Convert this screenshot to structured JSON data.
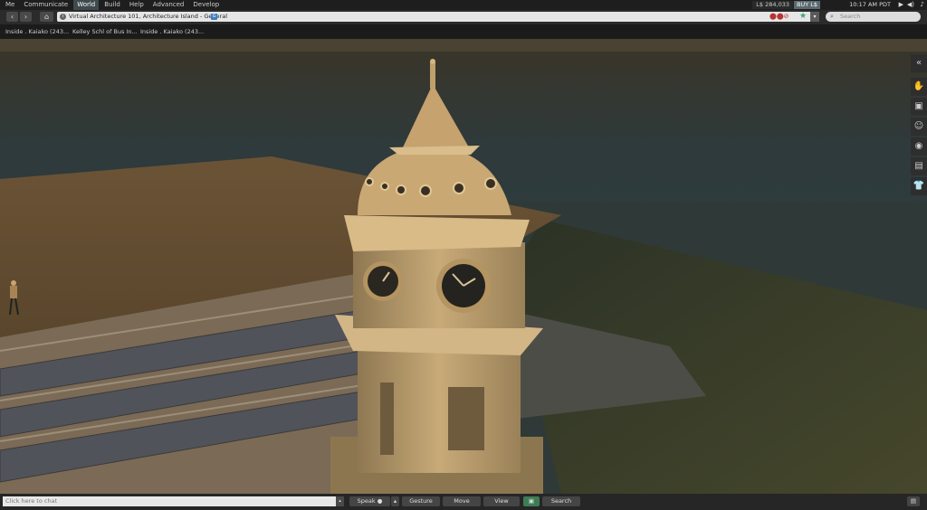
{
  "menu": {
    "items": [
      "Me",
      "Communicate",
      "World",
      "Build",
      "Help",
      "Advanced",
      "Develop"
    ],
    "active": "World",
    "balance": "L$ 284,033",
    "buy_label": "BUY L$",
    "clock": "10:17 AM PDT",
    "play_icon": "play-icon",
    "volume_icon": "volume-icon",
    "mic_icon": "mic-icon"
  },
  "nav": {
    "back_icon": "back-arrow-icon",
    "forward_icon": "forward-arrow-icon",
    "home_icon": "home-icon",
    "location": "Virtual Architecture 101, Architecture Island - General",
    "info_glyph": "i",
    "g_glyph": "G",
    "search_placeholder": "Search"
  },
  "favorites": [
    "Inside . Kaiako (243...",
    "Kelley Schl of Bus In...",
    "Inside . Kaiako (243..."
  ],
  "sidebar": {
    "icons": [
      "collapse-icon",
      "gesture-hand-icon",
      "profile-card-icon",
      "people-icon",
      "places-icon",
      "inventory-icon",
      "appearance-icon"
    ]
  },
  "bottom": {
    "chat_placeholder": "Click here to chat",
    "speak": "Speak",
    "gesture": "Gesture",
    "move": "Move",
    "view": "View",
    "search": "Search"
  },
  "colors": {
    "menu_bg": "#1e1e1e",
    "active_menu": "#3e4a4e",
    "sky": "#2f3a3c",
    "ground": "#3e3725",
    "tower": "#b89a6a"
  }
}
